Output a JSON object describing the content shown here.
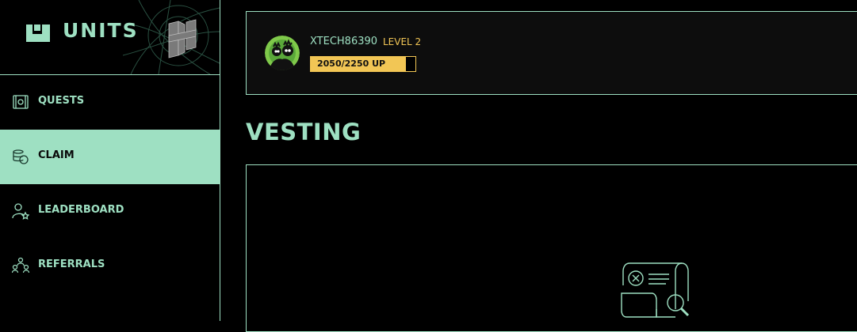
{
  "brand": {
    "logo_text": "UNITS"
  },
  "colors": {
    "accent": "#9ee0c2",
    "level": "#f2c655",
    "background": "#000000"
  },
  "sidebar": {
    "items": [
      {
        "label": "QUESTS",
        "icon": "quests-icon",
        "active": false
      },
      {
        "label": "CLAIM",
        "icon": "claim-icon",
        "active": true
      },
      {
        "label": "LEADERBOARD",
        "icon": "leaderboard-icon",
        "active": false
      },
      {
        "label": "REFERRALS",
        "icon": "referrals-icon",
        "active": false
      }
    ]
  },
  "user": {
    "username": "XTECH86390",
    "level": "LEVEL 2",
    "progress_text": "2050/2250 UP",
    "progress_current": 2050,
    "progress_max": 2250
  },
  "page": {
    "title": "VESTING"
  },
  "empty_state": {
    "icon": "empty-document-search-icon"
  }
}
